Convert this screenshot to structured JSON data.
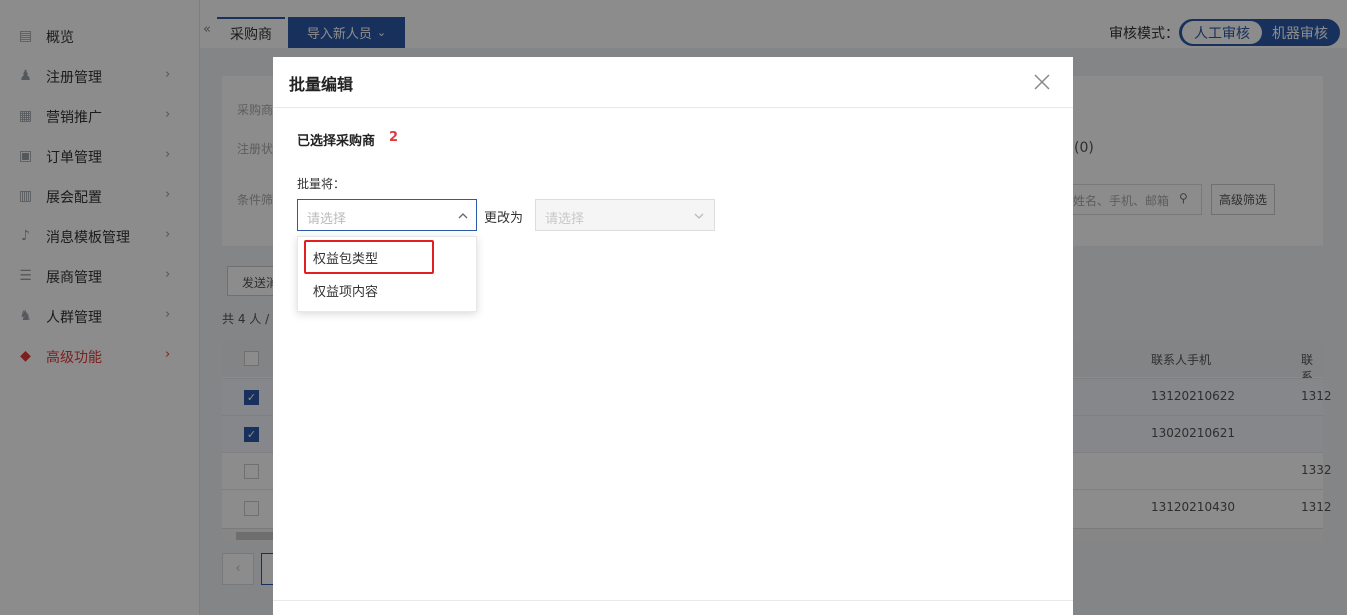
{
  "sidebar": {
    "items": [
      {
        "label": "概览",
        "icon": "overview-icon",
        "has_chevron": false
      },
      {
        "label": "注册管理",
        "icon": "user-icon",
        "has_chevron": true
      },
      {
        "label": "营销推广",
        "icon": "marketing-icon",
        "has_chevron": true
      },
      {
        "label": "订单管理",
        "icon": "order-icon",
        "has_chevron": true
      },
      {
        "label": "展会配置",
        "icon": "exhibition-icon",
        "has_chevron": true
      },
      {
        "label": "消息模板管理",
        "icon": "bell-icon",
        "has_chevron": true
      },
      {
        "label": "展商管理",
        "icon": "exhibitor-icon",
        "has_chevron": true
      },
      {
        "label": "人群管理",
        "icon": "group-icon",
        "has_chevron": true
      },
      {
        "label": "高级功能",
        "icon": "tag-icon",
        "has_chevron": true,
        "active": true
      }
    ],
    "chevron": "›",
    "active_color": "#e03a3a"
  },
  "topbar": {
    "collapse": "«",
    "active_tab": "采购商",
    "import_button": "导入新人员",
    "import_chevron": "⌄",
    "review_mode_label": "审核模式：",
    "review_modes": [
      "人工审核",
      "机器审核"
    ],
    "accent_color": "#2d5aa8"
  },
  "background": {
    "filter_label_1": "采购商",
    "filter_label_2": "注册状",
    "filter_label_3": "条件筛",
    "status_fragment": "(0)",
    "search_placeholder": "姓名、手机、邮箱",
    "advanced_filter": "高级筛选",
    "send_button": "发送消",
    "count_text": "共 4 人 / ",
    "columns": [
      "联系人手机",
      "联系"
    ],
    "rows": [
      {
        "checked": true,
        "phone": "13120210622",
        "extra": "1312"
      },
      {
        "checked": true,
        "phone": "13020210621",
        "extra": ""
      },
      {
        "checked": false,
        "phone": "",
        "extra": "1332"
      },
      {
        "checked": false,
        "phone": "13120210430",
        "extra": "1312"
      }
    ]
  },
  "modal": {
    "title": "批量编辑",
    "selected_label": "已选择采购商",
    "selected_count": "2",
    "batch_label": "批量将：",
    "select_placeholder": "请选择",
    "change_to": "更改为",
    "target_placeholder": "请选择",
    "options": [
      "权益包类型",
      "权益项内容"
    ],
    "highlighted_option": "权益包类型"
  }
}
